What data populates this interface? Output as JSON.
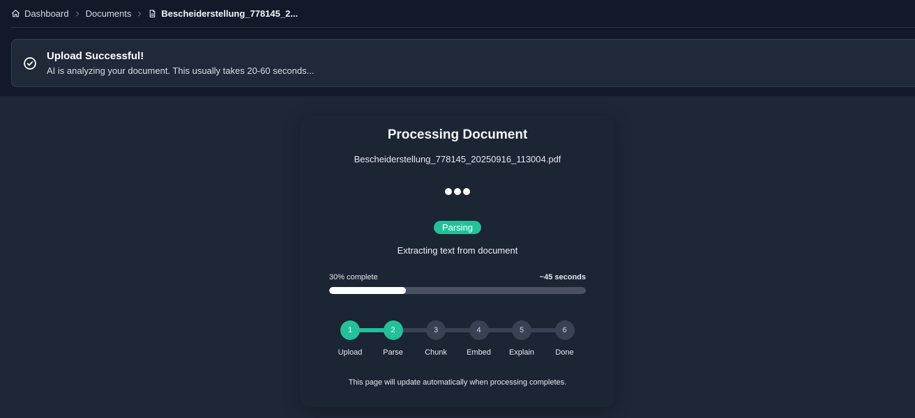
{
  "breadcrumb": {
    "items": [
      {
        "label": "Dashboard",
        "icon": "home-icon"
      },
      {
        "label": "Documents"
      },
      {
        "label": "Bescheiderstellung_778145_2...",
        "icon": "file-icon"
      }
    ]
  },
  "alert": {
    "icon": "check-circle-icon",
    "title": "Upload Successful!",
    "description": "AI is analyzing your document. This usually takes 20-60 seconds..."
  },
  "processing": {
    "title": "Processing Document",
    "file_name": "Bescheiderstellung_778145_20250916_113004.pdf",
    "status": "Parsing",
    "status_description": "Extracting text from document",
    "progress_label": "30% complete",
    "progress_percent": 30,
    "eta": "~45 seconds",
    "steps": [
      {
        "number": "1",
        "label": "Upload",
        "done": true
      },
      {
        "number": "2",
        "label": "Parse",
        "done": true
      },
      {
        "number": "3",
        "label": "Chunk",
        "done": false
      },
      {
        "number": "4",
        "label": "Embed",
        "done": false
      },
      {
        "number": "5",
        "label": "Explain",
        "done": false
      },
      {
        "number": "6",
        "label": "Done",
        "done": false
      }
    ],
    "footer_note": "This page will update automatically when processing completes."
  },
  "colors": {
    "accent": "#22c19a",
    "background": "#1e2736",
    "header_background": "#121a2a"
  }
}
